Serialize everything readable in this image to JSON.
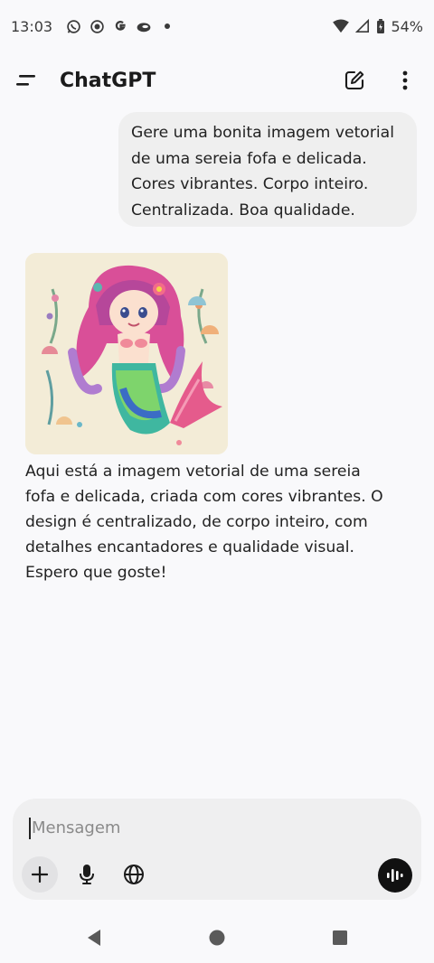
{
  "status_bar": {
    "time": "13:03",
    "battery": "54%",
    "notification_icons": [
      "whatsapp-icon",
      "record-icon",
      "google-icon",
      "cloud-icon",
      "dot-icon"
    ]
  },
  "header": {
    "title": "ChatGPT"
  },
  "conversation": {
    "user_message_lines": [
      "Gere uma bonita imagem vetorial",
      "de uma sereia fofa e delicada.",
      "Cores vibrantes. Corpo inteiro.",
      "Centralizada. Boa qualidade."
    ],
    "assistant_text_lines": [
      "Aqui está a imagem vetorial de uma sereia",
      "fofa e delicada, criada com cores vibrantes. O",
      "design é centralizado, de corpo inteiro, com",
      "detalhes encantadores e qualidade visual.",
      "Espero que goste!"
    ]
  },
  "composer": {
    "placeholder": "Mensagem"
  },
  "colors": {
    "background": "#f9f9fb",
    "bubble": "#efefef",
    "composer": "#efeff0",
    "voice_button": "#111111"
  }
}
